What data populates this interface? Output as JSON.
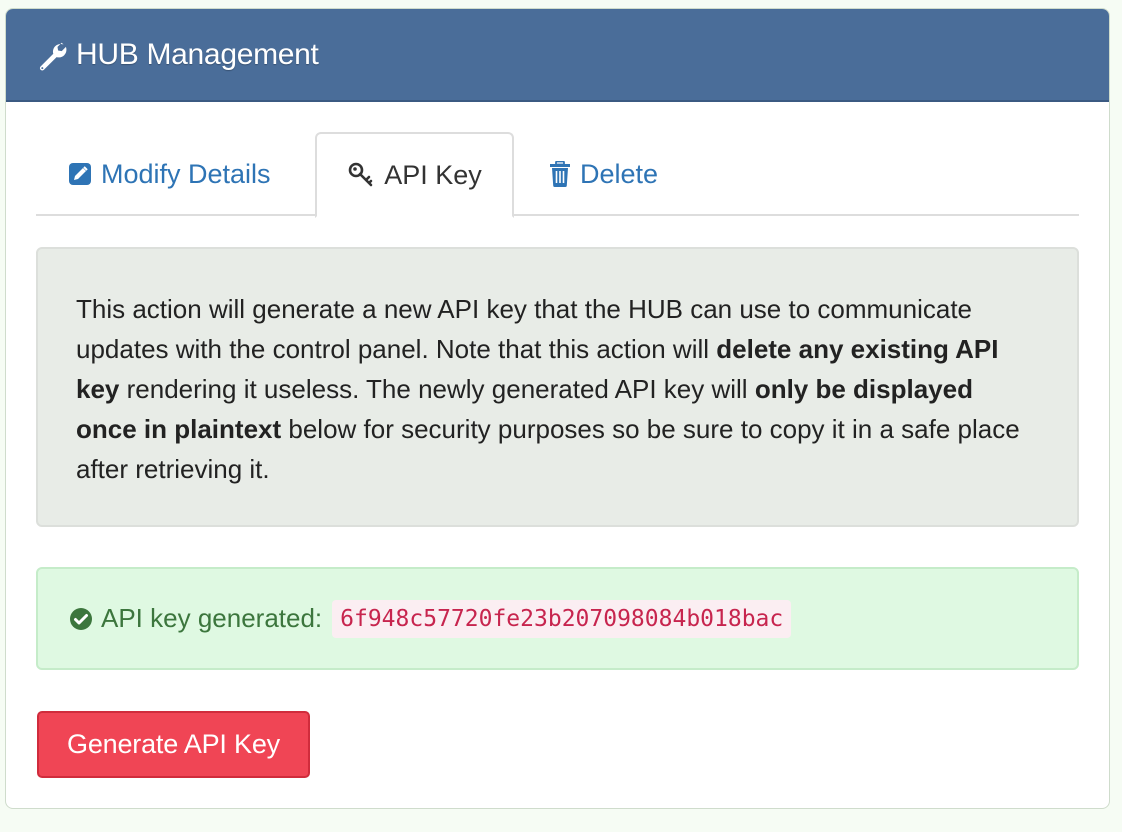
{
  "panel": {
    "title": "HUB Management",
    "title_icon": "wrench-icon"
  },
  "tabs": [
    {
      "label": "Modify Details",
      "icon": "edit-icon",
      "active": false
    },
    {
      "label": "API Key",
      "icon": "key-icon",
      "active": true
    },
    {
      "label": "Delete",
      "icon": "trash-icon",
      "active": false
    }
  ],
  "info": {
    "part1": "This action will generate a new API key that the HUB can use to communicate updates with the control panel. Note that this action will ",
    "bold1": "delete any existing API key",
    "part2": " rendering it useless. The newly generated API key will ",
    "bold2": "only be displayed once in plaintext",
    "part3": " below for security purposes so be sure to copy it in a safe place after retrieving it."
  },
  "alert": {
    "icon": "check-circle-icon",
    "label": "API key generated:",
    "key": "6f948c57720fe23b207098084b018bac"
  },
  "button": {
    "label": "Generate API Key"
  },
  "colors": {
    "header": "#4a6d99",
    "link": "#2e74b5",
    "success_text": "#3c763d",
    "success_bg": "#dff9e2",
    "danger": "#f04555",
    "code": "#c7254e"
  }
}
